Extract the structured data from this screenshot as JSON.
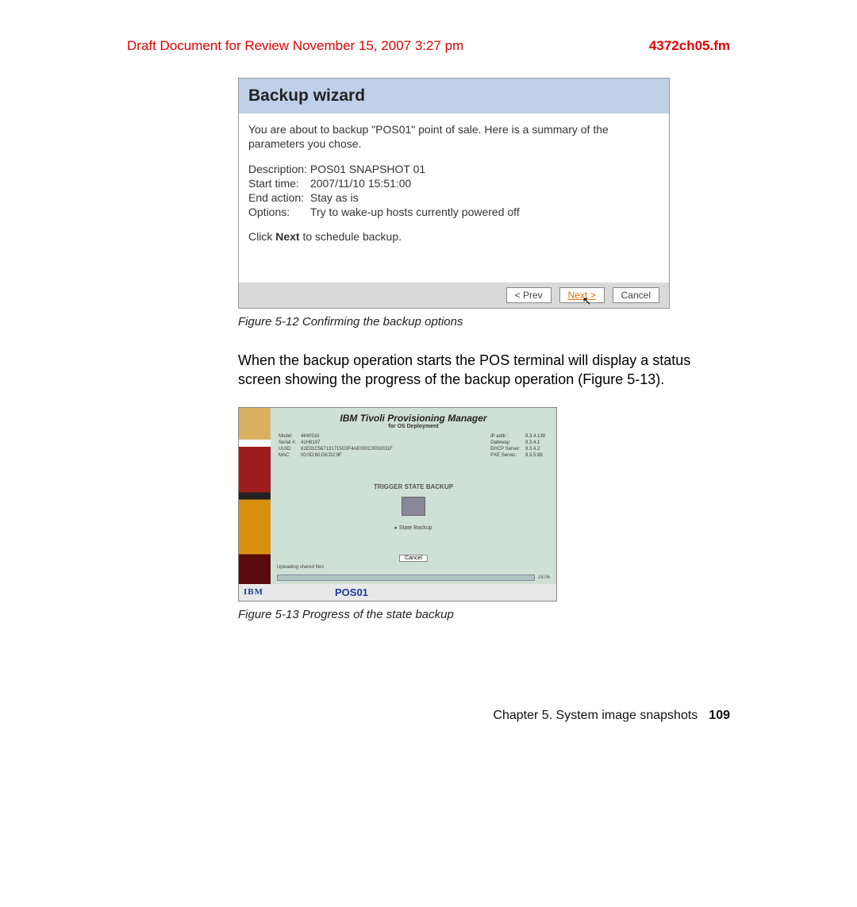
{
  "header": {
    "draft_text": "Draft Document for Review November 15, 2007 3:27 pm",
    "filename": "4372ch05.fm"
  },
  "wizard": {
    "title": "Backup wizard",
    "intro": "You are about to backup \"POS01\" point of sale. Here is a summary of the parameters you chose.",
    "params": [
      {
        "label": "Description:",
        "value": "POS01 SNAPSHOT 01"
      },
      {
        "label": "Start time:",
        "value": "2007/11/10 15:51:00"
      },
      {
        "label": "End action:",
        "value": "Stay as is"
      },
      {
        "label": "Options:",
        "value": "Try to wake-up hosts currently powered off"
      }
    ],
    "click_prefix": "Click ",
    "click_bold": "Next",
    "click_suffix": " to schedule backup.",
    "buttons": {
      "prev": "< Prev",
      "next": "Next >",
      "cancel": "Cancel"
    }
  },
  "figure1_caption": "Figure 5-12   Confirming the backup options",
  "body_paragraph": "When the backup operation starts the POS terminal will display a status screen showing the progress of the backup operation (Figure 5-13).",
  "tpm": {
    "title": "IBM Tivoli Provisioning Manager",
    "subtitle": "for OS Deployment",
    "left_labels": [
      "Model:",
      "Serial #:",
      "UUID:",
      "MAC:"
    ],
    "left_values": [
      "4840533",
      "41H8197",
      "81E01C587131715C0F4AE000C0050031F",
      "00:0D:60:D6:D2:9F"
    ],
    "right_labels": [
      "IP addr.:",
      "Gateway:",
      "DHCP Server:",
      "PXE Server:"
    ],
    "right_values": [
      "9.3.4.139",
      "9.3.4.1",
      "9.3.4.2",
      "9.3.5.88"
    ],
    "center_heading": "TRIGGER STATE BACKUP",
    "backup_item": "▸ State Backup",
    "cancel": "Cancel",
    "status": "Uploading shared files",
    "time": "16:06",
    "ibm": "IBM",
    "pos": "POS01"
  },
  "figure2_caption": "Figure 5-13   Progress of the state backup",
  "footer": {
    "chapter": "Chapter 5. System image snapshots",
    "page": "109"
  }
}
